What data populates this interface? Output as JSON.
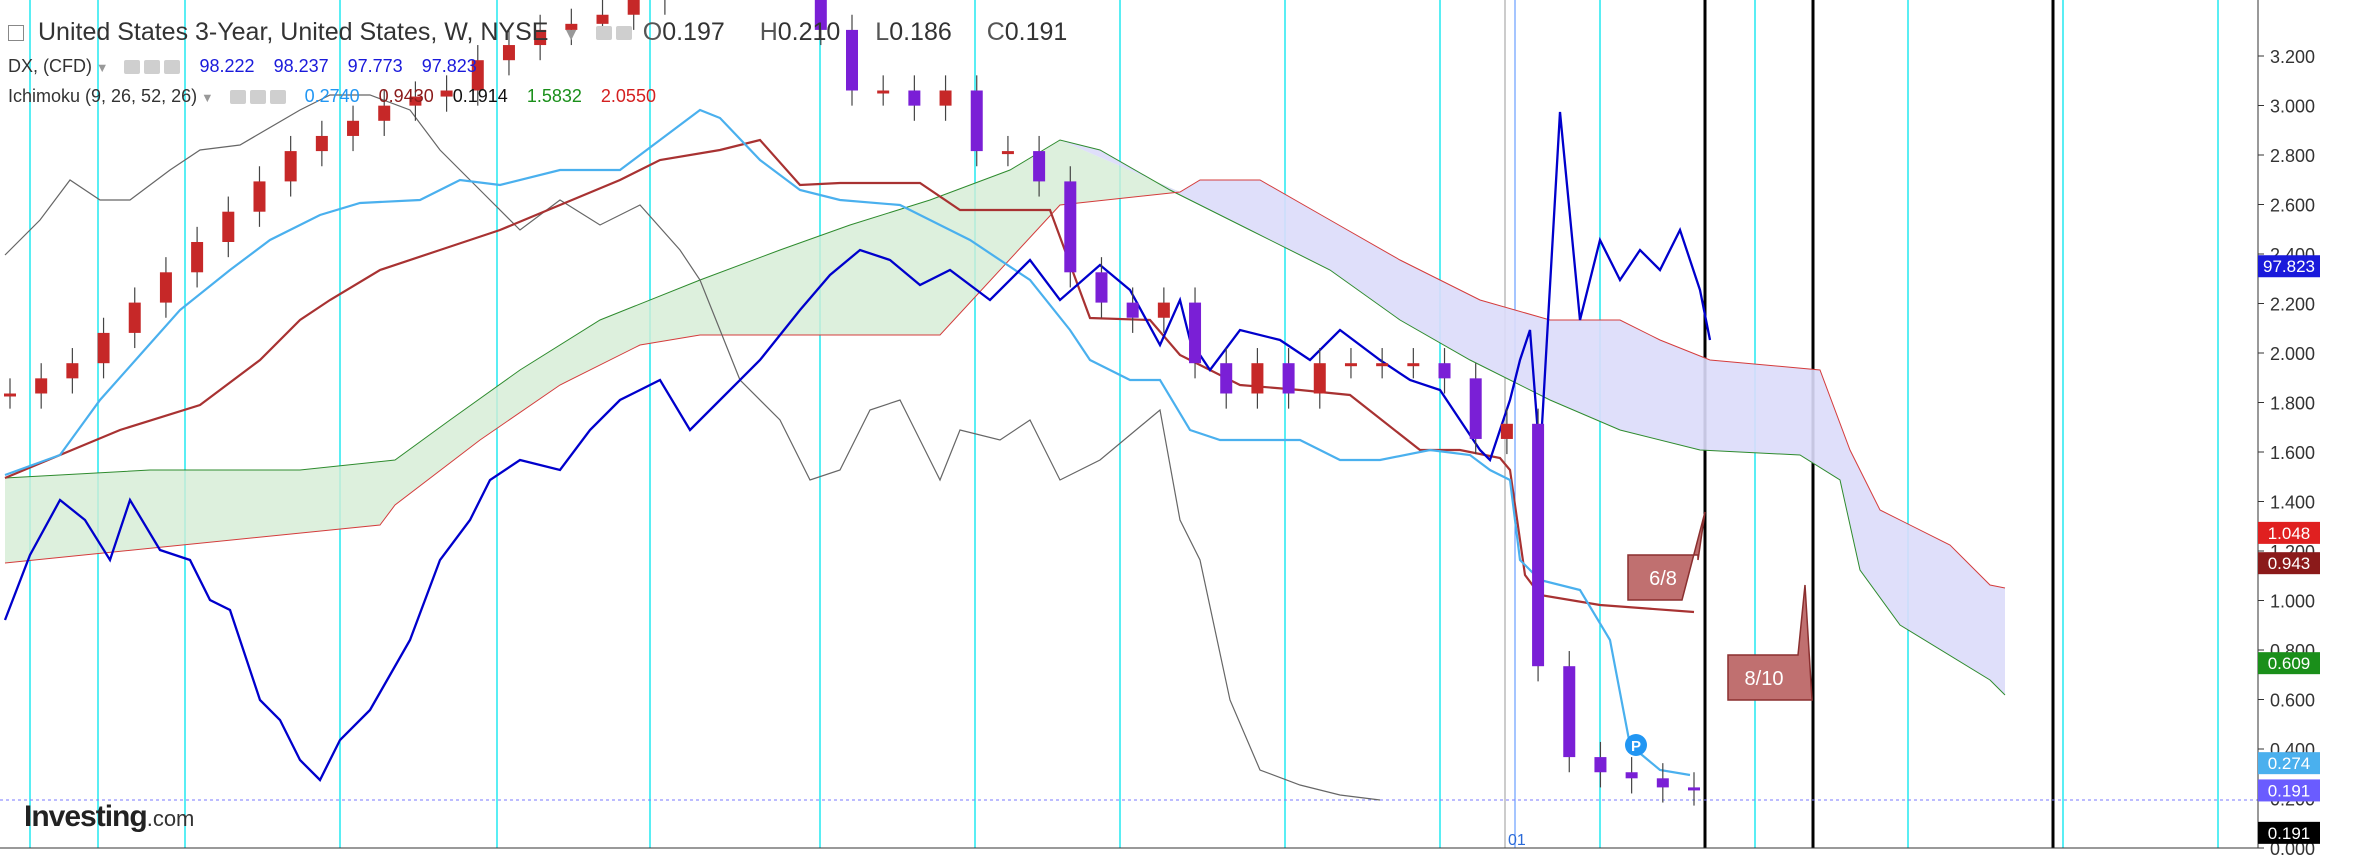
{
  "header": {
    "title": "United States 3-Year, United States, W, NYSE",
    "ohlc": {
      "O": "0.197",
      "H": "0.210",
      "L": "0.186",
      "C": "0.191"
    },
    "dx": {
      "label": "DX, (CFD)",
      "v1": "98.222",
      "v2": "98.237",
      "v3": "97.773",
      "v4": "97.823"
    },
    "ichimoku": {
      "label": "Ichimoku (9, 26, 52, 26)",
      "v1": "0.2740",
      "v2": "0.9430",
      "v3": "0.1914",
      "v4": "1.5832",
      "v5": "2.0550"
    }
  },
  "logo": {
    "name": "Investing",
    "suffix": ".com"
  },
  "colors": {
    "dx_line": "#0000cc",
    "tenkan": "#4ab0ee",
    "kijun": "#a83232",
    "chikou": "#666666",
    "span_a": "#2e8b2e",
    "span_b": "#d43c3c",
    "cloud_bull": "#d4ecd4",
    "cloud_bear": "#dcdcfa",
    "candle_up": "#c62828",
    "candle_down": "#7a1fd6",
    "cycle_line": "#00e5ee"
  },
  "chart_data": {
    "type": "line",
    "title": "United States 3-Year, United States, W, NYSE",
    "y_ticks": [
      "3.200",
      "3.000",
      "2.800",
      "2.600",
      "2.400",
      "2.200",
      "2.000",
      "1.800",
      "1.600",
      "1.400",
      "1.200",
      "1.000",
      "0.800",
      "0.600",
      "0.400",
      "0.200",
      "0.000"
    ],
    "ylim": [
      0,
      3.3
    ],
    "x_label": "01",
    "price_labels": [
      {
        "text": "97.823",
        "value": 1.92,
        "color": "#1a1adb"
      },
      {
        "text": "1.048",
        "value": 1.04,
        "color": "#e02020"
      },
      {
        "text": "0.943",
        "value": 0.94,
        "color": "#8b1a1a"
      },
      {
        "text": "0.609",
        "value": 0.61,
        "color": "#1a8f1a"
      },
      {
        "text": "0.274",
        "value": 0.28,
        "color": "#4ab0ee"
      },
      {
        "text": "0.191",
        "value": 0.19,
        "color": "#6a5cff"
      },
      {
        "text": "0.191",
        "value": 0.05,
        "color": "#000000"
      }
    ],
    "callouts": [
      {
        "text": "6/8"
      },
      {
        "text": "8/10"
      },
      {
        "text": "P"
      }
    ],
    "series": [
      {
        "name": "United States 3-Year",
        "values": [
          1.5,
          1.55,
          1.6,
          1.7,
          1.8,
          1.9,
          2.0,
          2.1,
          2.2,
          2.3,
          2.35,
          2.4,
          2.45,
          2.48,
          2.5,
          2.6,
          2.65,
          2.7,
          2.72,
          2.75,
          2.8,
          2.85,
          2.9,
          3.0,
          3.0,
          2.9,
          2.7,
          2.5,
          2.5,
          2.45,
          2.5,
          2.3,
          2.3,
          2.2,
          1.9,
          1.8,
          1.75,
          1.8,
          1.6,
          1.5,
          1.6,
          1.5,
          1.6,
          1.6,
          1.6,
          1.6,
          1.55,
          1.35,
          1.4,
          0.6,
          0.3,
          0.25,
          0.23,
          0.2,
          0.19
        ]
      },
      {
        "name": "DX, (CFD)",
        "values": [
          91,
          93,
          93.5,
          92,
          89,
          87.5,
          88,
          87,
          89,
          92,
          93,
          95,
          94,
          95,
          94.5,
          96,
          97,
          96.5,
          96,
          97,
          97.5,
          96,
          96,
          97.5,
          97,
          98,
          96.5,
          96,
          98,
          97,
          96,
          95,
          95.5,
          94.5,
          95,
          97,
          96,
          94.5,
          96,
          95.5,
          95,
          94,
          95.5,
          96.5,
          98,
          95,
          99,
          101,
          99.5,
          100,
          98,
          97.8
        ]
      },
      {
        "name": "Ichimoku Tenkan",
        "values": [
          1.5,
          1.6,
          1.8,
          2.0,
          2.2,
          2.4,
          2.55,
          2.6,
          2.6,
          2.7,
          2.8,
          2.9,
          2.85,
          2.6,
          2.55,
          2.4,
          2.2,
          2.0,
          1.8,
          1.65,
          1.62,
          1.6,
          1.6,
          1.58,
          1.55,
          1.5,
          0.8,
          0.4,
          0.28,
          0.27
        ]
      },
      {
        "name": "Ichimoku Kijun",
        "values": [
          1.5,
          1.6,
          1.7,
          1.9,
          2.1,
          2.3,
          2.5,
          2.6,
          2.7,
          2.7,
          2.6,
          2.6,
          2.2,
          2.1,
          1.9,
          1.85,
          1.85,
          1.65,
          1.65,
          1.6,
          1.6,
          1.0,
          0.95,
          0.943
        ]
      }
    ]
  }
}
